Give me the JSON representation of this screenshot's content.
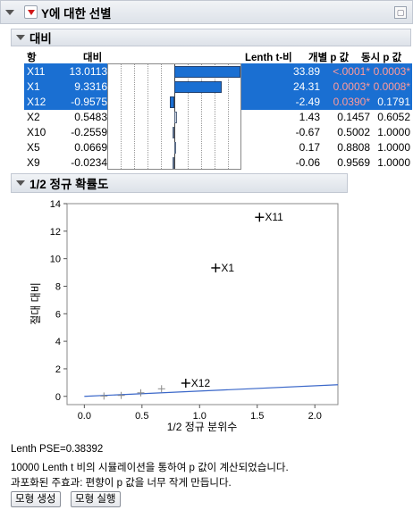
{
  "report": {
    "title": "Y에 대한 선별"
  },
  "contrasts": {
    "title": "대비",
    "columns": [
      "항",
      "대비",
      "Lenth t-비",
      "개별 p 값",
      "동시 p 값"
    ],
    "rows": [
      {
        "term": "X11",
        "contrast": "13.0113",
        "lenth_t": "33.89",
        "ind_p": "<.0001*",
        "sim_p": "0.0003*",
        "selected": true,
        "ind_red": true,
        "sim_red": true,
        "value": 13.0113
      },
      {
        "term": "X1",
        "contrast": "9.3316",
        "lenth_t": "24.31",
        "ind_p": "0.0003*",
        "sim_p": "0.0008*",
        "selected": true,
        "ind_red": true,
        "sim_red": true,
        "value": 9.3316
      },
      {
        "term": "X12",
        "contrast": "-0.9575",
        "lenth_t": "-2.49",
        "ind_p": "0.0390*",
        "sim_p": "0.1791",
        "selected": true,
        "ind_red": true,
        "sim_red": false,
        "value": -0.9575
      },
      {
        "term": "X2",
        "contrast": "0.5483",
        "lenth_t": "1.43",
        "ind_p": "0.1457",
        "sim_p": "0.6052",
        "selected": false,
        "ind_red": false,
        "sim_red": false,
        "value": 0.5483
      },
      {
        "term": "X10",
        "contrast": "-0.2559",
        "lenth_t": "-0.67",
        "ind_p": "0.5002",
        "sim_p": "1.0000",
        "selected": false,
        "ind_red": false,
        "sim_red": false,
        "value": -0.2559
      },
      {
        "term": "X5",
        "contrast": "0.0669",
        "lenth_t": "0.17",
        "ind_p": "0.8808",
        "sim_p": "1.0000",
        "selected": false,
        "ind_red": false,
        "sim_red": false,
        "value": 0.0669
      },
      {
        "term": "X9",
        "contrast": "-0.0234",
        "lenth_t": "-0.06",
        "ind_p": "0.9569",
        "sim_p": "1.0000",
        "selected": false,
        "ind_red": false,
        "sim_red": false,
        "value": -0.0234
      }
    ]
  },
  "half_normal": {
    "title": "1/2 정규 확률도",
    "chart_data": {
      "type": "scatter",
      "xlabel": "1/2 정규 분위수",
      "ylabel": "절대 대비",
      "xlim": [
        -0.15,
        2.2
      ],
      "ylim": [
        -0.6,
        14
      ],
      "xticks": [
        "0.0",
        "0.5",
        "1.0",
        "1.5",
        "2.0"
      ],
      "xtick_values": [
        0,
        0.5,
        1,
        1.5,
        2
      ],
      "yticks": [
        "0",
        "2",
        "4",
        "6",
        "8",
        "10",
        "12",
        "14"
      ],
      "ytick_values": [
        0,
        2,
        4,
        6,
        8,
        10,
        12,
        14
      ],
      "points": [
        {
          "x": 0.17,
          "y": 0.0234,
          "label": ""
        },
        {
          "x": 0.32,
          "y": 0.0669,
          "label": ""
        },
        {
          "x": 0.49,
          "y": 0.2559,
          "label": ""
        },
        {
          "x": 0.67,
          "y": 0.5483,
          "label": ""
        },
        {
          "x": 0.88,
          "y": 0.9575,
          "label": "X12"
        },
        {
          "x": 1.14,
          "y": 9.3316,
          "label": "X1"
        },
        {
          "x": 1.52,
          "y": 13.0113,
          "label": "X11"
        }
      ],
      "line": {
        "x": [
          0,
          2.2
        ],
        "y": [
          0,
          0.845
        ],
        "color": "#3a67c9"
      }
    }
  },
  "footer": {
    "pse": "Lenth PSE=0.38392",
    "sim_note": "10000 Lenth t 비의 시뮬레이션을 통하여 p 값이 계산되었습니다.",
    "warn": "과포화된 주효과: 편향이 p 값을 너무 작게 만듭니다."
  },
  "buttons": {
    "make_model": "모형 생성",
    "run_model": "모형 실행"
  },
  "colors": {
    "selection": "#1a6fd2",
    "significant_p": "#ff5b5b",
    "fit_line": "#3a67c9"
  }
}
